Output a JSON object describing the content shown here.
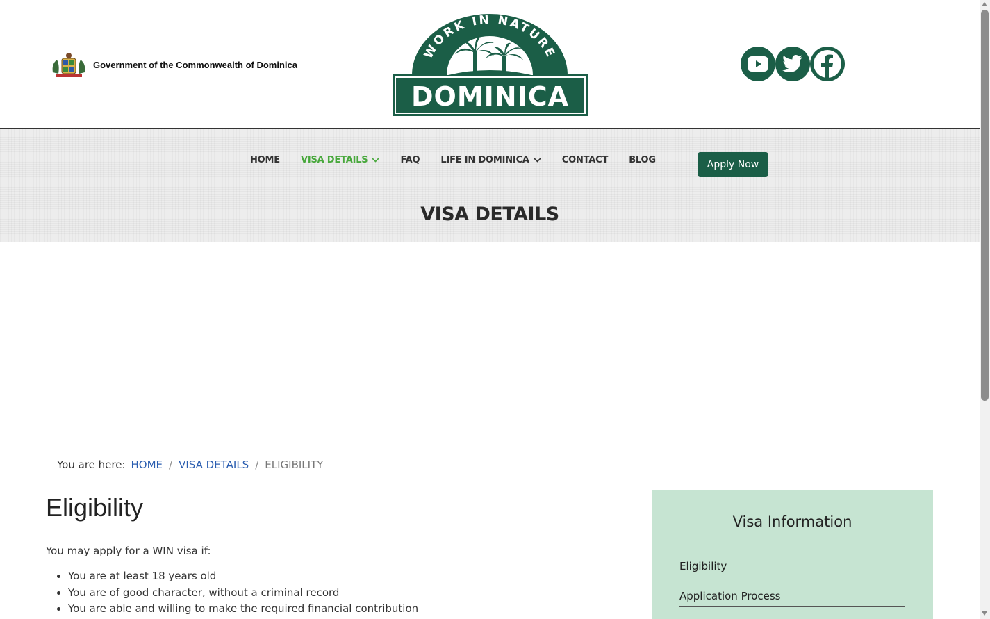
{
  "header": {
    "gov_text": "Government of the Commonwealth of Dominica",
    "logo_arc_text": "WORK IN NATURE",
    "logo_word": "DOMINICA",
    "social": [
      "youtube-icon",
      "twitter-icon",
      "facebook-icon"
    ]
  },
  "nav": {
    "items": [
      {
        "label": "HOME"
      },
      {
        "label": "VISA DETAILS"
      },
      {
        "label": "FAQ"
      },
      {
        "label": "LIFE IN DOMINICA"
      },
      {
        "label": "CONTACT"
      },
      {
        "label": "BLOG"
      }
    ],
    "apply_label": "Apply Now"
  },
  "band": {
    "title": "VISA DETAILS"
  },
  "breadcrumb": {
    "lead": "You are here:",
    "home": "HOME",
    "visa": "VISA DETAILS",
    "current": "ELIGIBILITY",
    "separator": "/"
  },
  "content": {
    "title": "Eligibility",
    "intro": "You may apply for a WIN visa if:",
    "bullets": [
      "You are at least 18 years old",
      "You are of good character, without a criminal record",
      "You are able and willing to make the required financial contribution"
    ]
  },
  "sidebar": {
    "title": "Visa Information",
    "links": [
      "Eligibility",
      "Application Process"
    ]
  },
  "colors": {
    "brand_green": "#1b5e47",
    "active_nav": "#48a83c",
    "sidebar_bg": "#c6e4d2",
    "link_blue": "#2a5db0"
  }
}
